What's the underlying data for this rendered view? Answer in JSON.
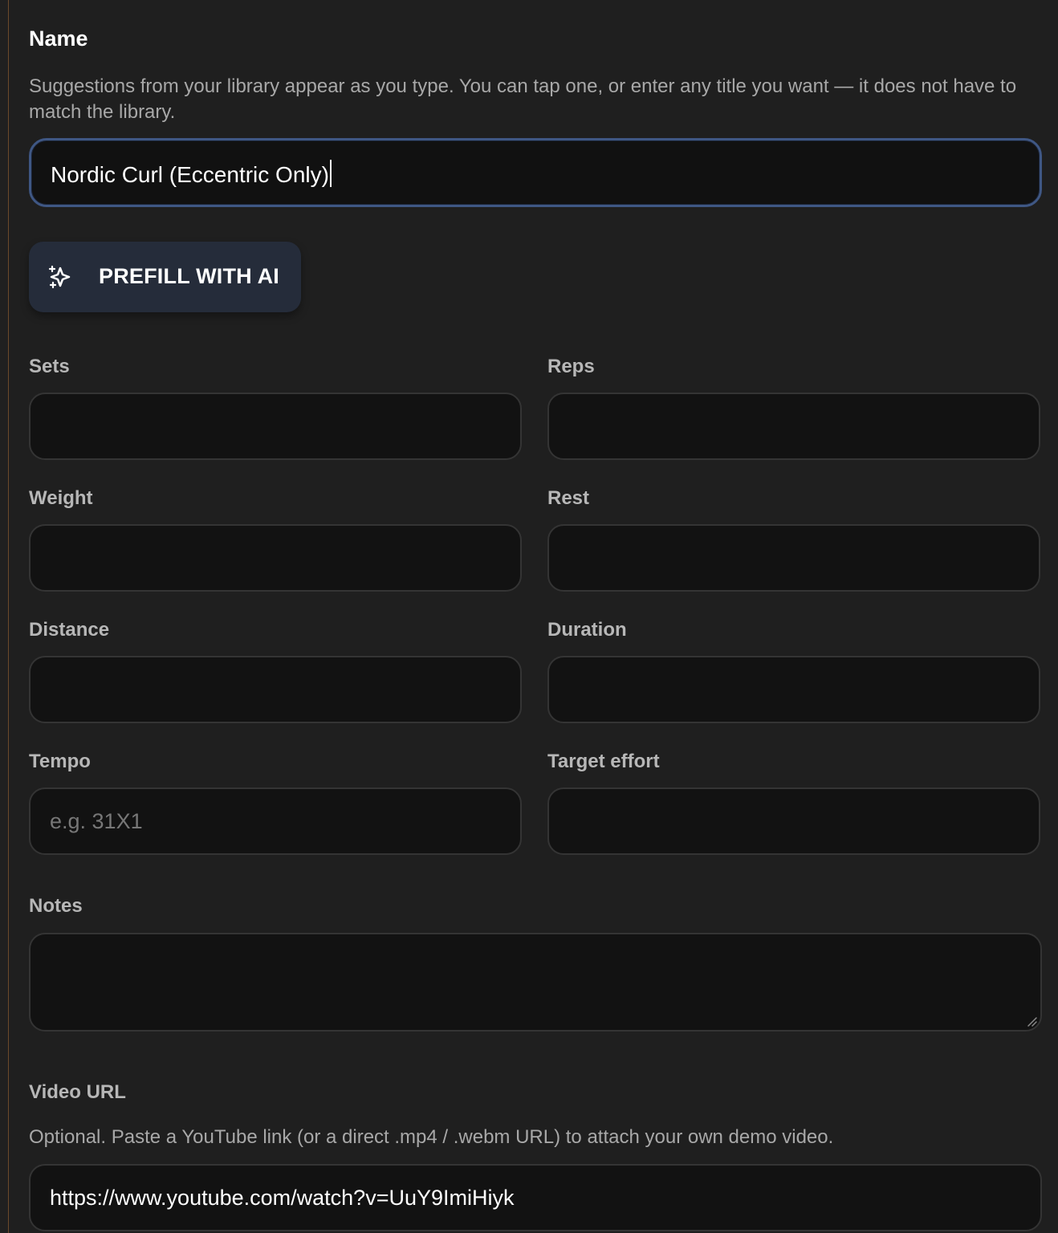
{
  "name_section": {
    "label": "Name",
    "help": "Suggestions from your library appear as you type. You can tap one, or enter any title you want — it does not have to match the library.",
    "value": "Nordic Curl (Eccentric Only)"
  },
  "ai_button": {
    "label": "PREFILL WITH AI",
    "icon": "sparkle-icon"
  },
  "fields": {
    "sets": {
      "label": "Sets",
      "value": ""
    },
    "reps": {
      "label": "Reps",
      "value": ""
    },
    "weight": {
      "label": "Weight",
      "value": ""
    },
    "rest": {
      "label": "Rest",
      "value": ""
    },
    "distance": {
      "label": "Distance",
      "value": ""
    },
    "duration": {
      "label": "Duration",
      "value": ""
    },
    "tempo": {
      "label": "Tempo",
      "value": "",
      "placeholder": "e.g. 31X1"
    },
    "target_effort": {
      "label": "Target effort",
      "value": ""
    },
    "notes": {
      "label": "Notes",
      "value": ""
    }
  },
  "video": {
    "label": "Video URL",
    "help": "Optional. Paste a YouTube link (or a direct .mp4 / .webm URL) to attach your own demo video.",
    "value": "https://www.youtube.com/watch?v=UuY9ImiHiyk"
  },
  "colors": {
    "background": "#1f1f1f",
    "field_background": "#121212",
    "focus_border": "#3f5784",
    "button_background": "#252c3a",
    "rail_border": "#6b4a2a"
  }
}
